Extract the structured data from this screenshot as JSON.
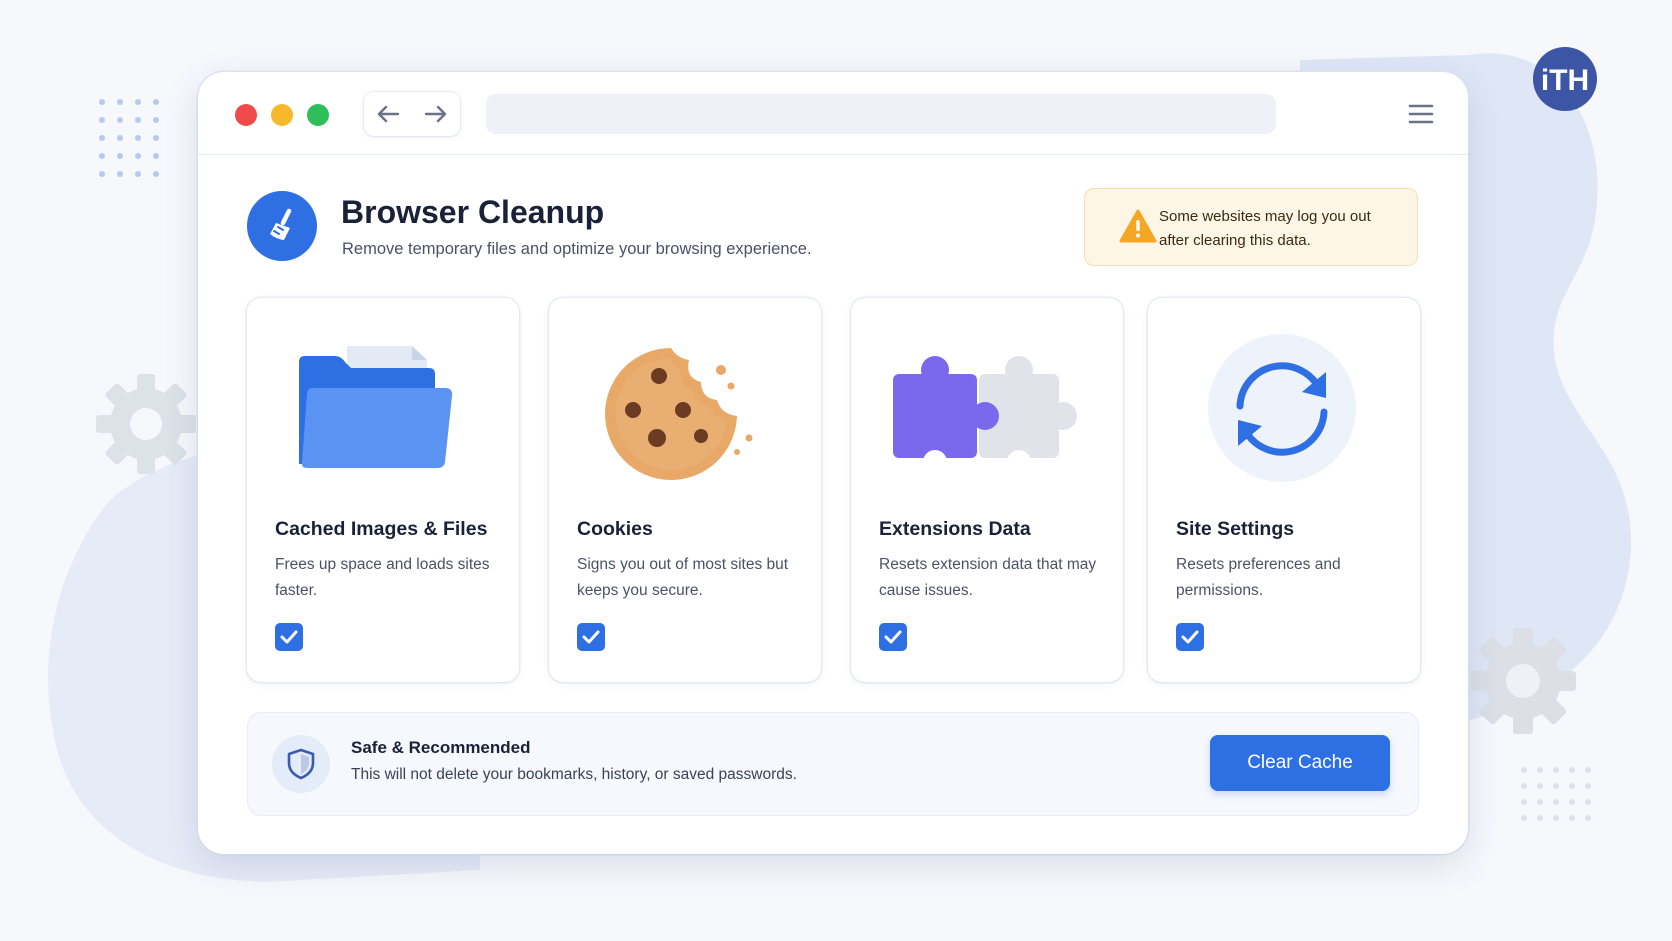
{
  "header": {
    "title": "Browser Cleanup",
    "subtitle": "Remove temporary files and optimize your browsing experience.",
    "app_icon": "broom-icon"
  },
  "warning": {
    "icon": "warning-triangle-icon",
    "text": "Some websites may log you out after clearing this data."
  },
  "cards": [
    {
      "title": "Cached Images & Files",
      "description": "Frees up space and loads sites faster.",
      "icon": "folder-icon",
      "checked": true
    },
    {
      "title": "Cookies",
      "description": "Signs you out of most sites but keeps you secure.",
      "icon": "cookie-icon",
      "checked": true
    },
    {
      "title": "Extensions Data",
      "description": "Resets extension data that may cause issues.",
      "icon": "puzzle-icon",
      "checked": true
    },
    {
      "title": "Site Settings",
      "description": "Resets preferences and permissions.",
      "icon": "sync-icon",
      "checked": true
    }
  ],
  "footer": {
    "title": "Safe & Recommended",
    "description": "This will not delete your bookmarks, history, or saved passwords.",
    "icon": "shield-icon",
    "button_label": "Clear Cache"
  },
  "brand": {
    "logo": "ith-logo-icon",
    "logo_text": "iTH"
  },
  "colors": {
    "accent": "#2f6fe4",
    "warning_bg": "#fdf6e6",
    "warning_icon": "#f5a623",
    "close": "#f04a4a",
    "minimize": "#f7b82b",
    "maximize": "#2fbf5a"
  }
}
